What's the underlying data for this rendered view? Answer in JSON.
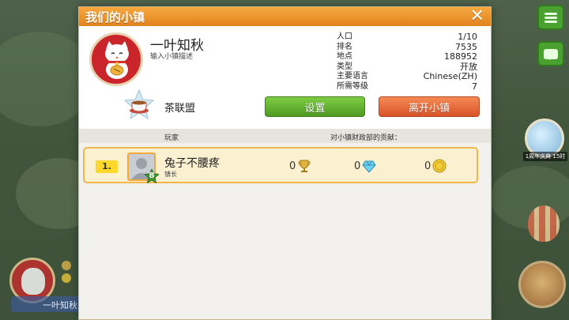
{
  "dialog": {
    "title": "我们的小镇",
    "close_label": "✕"
  },
  "town": {
    "name": "一叶知秋",
    "description": "输入小镇描述",
    "alliance": "茶联盟",
    "stats": [
      {
        "label": "人口",
        "value": "1/10"
      },
      {
        "label": "排名",
        "value": "7535"
      },
      {
        "label": "地点",
        "value": "188952"
      },
      {
        "label": "类型",
        "value": "开放"
      },
      {
        "label": "主要语言",
        "value": "Chinese(ZH)"
      },
      {
        "label": "所需等级",
        "value": "7"
      }
    ]
  },
  "buttons": {
    "settings": "设置",
    "leave": "离开小镇"
  },
  "columns": {
    "player": "玩家",
    "contribution": "对小镇财政部的贡献："
  },
  "members": [
    {
      "rank": "1.",
      "name": "兔子不腰疼",
      "role": "镇长",
      "level": "8",
      "trophies": "0",
      "diamonds": "0",
      "coins": "0"
    }
  ],
  "background": {
    "event_label": "1周年庆典 15时",
    "player_name": "一叶知秋"
  },
  "colors": {
    "header_orange": "#e2821f",
    "settings_green": "#4f9a23",
    "leave_orange": "#d9532a",
    "row_highlight": "#fbf0cf"
  }
}
